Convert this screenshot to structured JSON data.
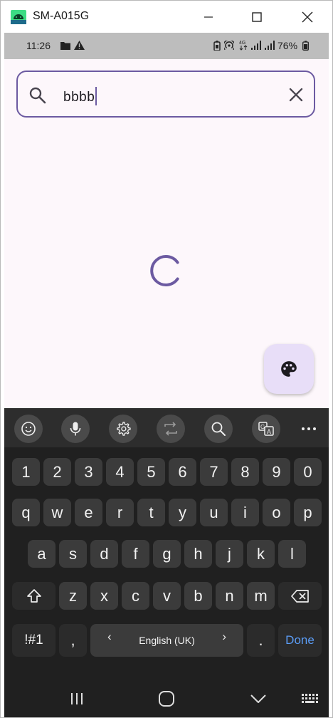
{
  "window": {
    "title": "SM-A015G",
    "controls": [
      "minimize-icon",
      "maximize-icon",
      "close-icon"
    ]
  },
  "status_bar": {
    "time": "11:26",
    "left_icons": [
      "folder-icon",
      "warning-icon"
    ],
    "right_icons": [
      "battery-saver-icon",
      "hotspot-icon",
      "data-4g-icon",
      "signal-icon",
      "signal-icon-2",
      "battery-icon"
    ],
    "battery_percent": "76%"
  },
  "search": {
    "value": "bbbb",
    "search_icon": "search-icon",
    "clear_icon": "clear-icon"
  },
  "content": {
    "state": "loading",
    "indicator": "loading-spinner"
  },
  "fab": {
    "icon": "palette-icon"
  },
  "keyboard": {
    "toolbar": [
      "emoji-icon",
      "microphone-icon",
      "settings-icon",
      "swap-icon",
      "search-icon",
      "translate-icon",
      "more-icon"
    ],
    "rows": [
      [
        "1",
        "2",
        "3",
        "4",
        "5",
        "6",
        "7",
        "8",
        "9",
        "0"
      ],
      [
        "q",
        "w",
        "e",
        "r",
        "t",
        "y",
        "u",
        "i",
        "o",
        "p"
      ],
      [
        "a",
        "s",
        "d",
        "f",
        "g",
        "h",
        "j",
        "k",
        "l"
      ],
      [
        "z",
        "x",
        "c",
        "v",
        "b",
        "n",
        "m"
      ]
    ],
    "shift_icon": "shift-icon",
    "backspace_icon": "backspace-icon",
    "symbols_label": "!#1",
    "comma_label": ",",
    "space_label": "English (UK)",
    "left_arrow": "‹",
    "right_arrow": "›",
    "period_label": ".",
    "done_label": "Done"
  },
  "nav_bar": [
    "recents-icon",
    "home-icon",
    "back-icon",
    "keyboard-switch-icon"
  ]
}
